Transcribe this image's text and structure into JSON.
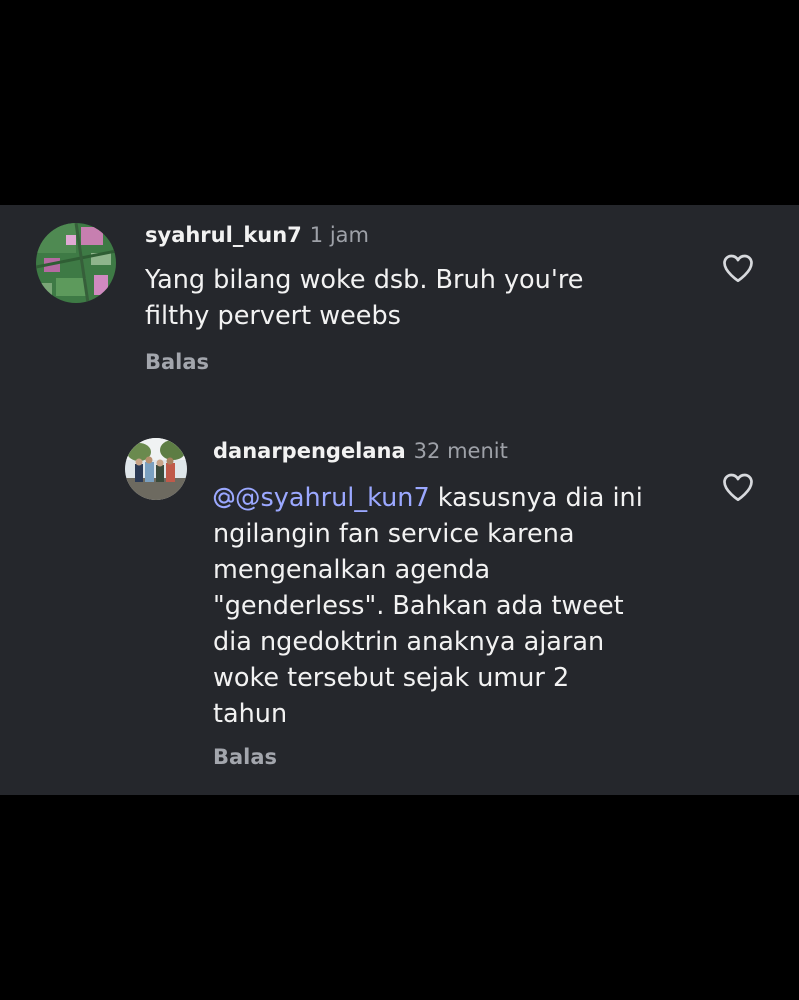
{
  "comments": [
    {
      "username": "syahrul_kun7",
      "time": "1 jam",
      "text_lines": [
        "Yang bilang woke dsb. Bruh you're",
        "filthy pervert weebs"
      ],
      "reply_label": "Balas",
      "avatar_icon": "avatar-image",
      "like_icon": "heart-outline-icon"
    },
    {
      "username": "danarpengelana",
      "time": "32 menit",
      "mention": "@syahrul_kun7",
      "mention_icon": "threads-at-icon",
      "text_first_line_rest": " kasusnya dia ini",
      "text_lines": [
        "ngilangin fan service karena",
        "mengenalkan agenda",
        "\"genderless\". Bahkan ada tweet",
        "dia ngedoktrin anaknya ajaran",
        "woke tersebut sejak umur 2",
        "tahun"
      ],
      "reply_label": "Balas",
      "avatar_icon": "avatar-image",
      "like_icon": "heart-outline-icon"
    }
  ],
  "colors": {
    "panel_bg": "#25272c",
    "outer_bg": "#000000",
    "text": "#f2f2f2",
    "muted": "#9ea1a8",
    "mention": "#9ba8ff"
  }
}
